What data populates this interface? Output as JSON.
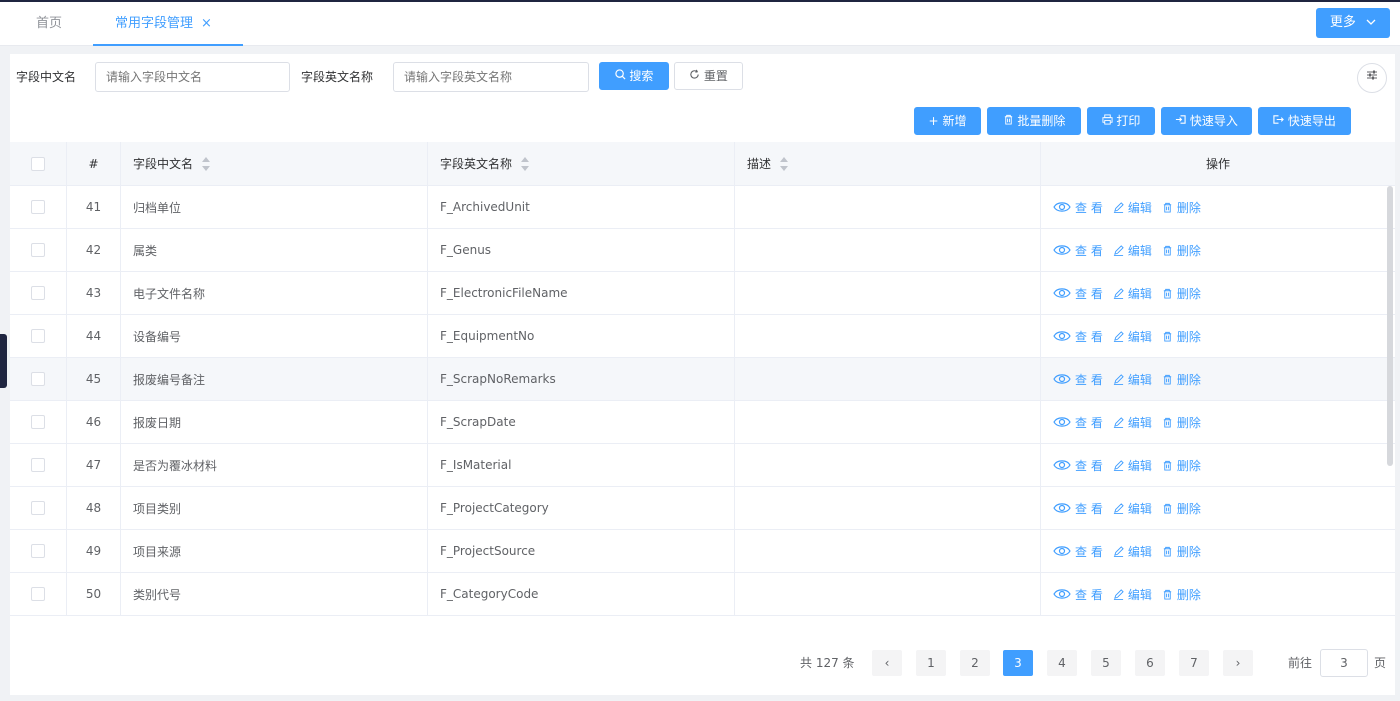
{
  "tabs": {
    "home": "首页",
    "active": "常用字段管理",
    "close": "×",
    "more": "更多"
  },
  "search": {
    "cn_label": "字段中文名",
    "cn_placeholder": "请输入字段中文名",
    "en_label": "字段英文名称",
    "en_placeholder": "请输入字段英文名称",
    "search_btn": "搜索",
    "reset_btn": "重置"
  },
  "toolbar": {
    "add": "新增",
    "batch_delete": "批量删除",
    "print": "打印",
    "import": "快速导入",
    "export": "快速导出"
  },
  "table": {
    "headers": {
      "index": "#",
      "cn": "字段中文名",
      "en": "字段英文名称",
      "desc": "描述",
      "op": "操作"
    },
    "actions": {
      "view": "查 看",
      "edit": "编辑",
      "delete": "删除"
    },
    "rows": [
      {
        "index": "41",
        "cn": "归档单位",
        "en": "F_ArchivedUnit",
        "desc": ""
      },
      {
        "index": "42",
        "cn": "属类",
        "en": "F_Genus",
        "desc": ""
      },
      {
        "index": "43",
        "cn": "电子文件名称",
        "en": "F_ElectronicFileName",
        "desc": ""
      },
      {
        "index": "44",
        "cn": "设备编号",
        "en": "F_EquipmentNo",
        "desc": ""
      },
      {
        "index": "45",
        "cn": "报废编号备注",
        "en": "F_ScrapNoRemarks",
        "desc": ""
      },
      {
        "index": "46",
        "cn": "报废日期",
        "en": "F_ScrapDate",
        "desc": ""
      },
      {
        "index": "47",
        "cn": "是否为覆冰材料",
        "en": "F_IsMaterial",
        "desc": ""
      },
      {
        "index": "48",
        "cn": "项目类别",
        "en": "F_ProjectCategory",
        "desc": ""
      },
      {
        "index": "49",
        "cn": "项目来源",
        "en": "F_ProjectSource",
        "desc": ""
      },
      {
        "index": "50",
        "cn": "类别代号",
        "en": "F_CategoryCode",
        "desc": ""
      }
    ]
  },
  "pagination": {
    "total": "共 127 条",
    "prev": "‹",
    "next": "›",
    "pages": [
      "1",
      "2",
      "3",
      "4",
      "5",
      "6",
      "7"
    ],
    "current": "3",
    "goto_label": "前往",
    "goto_value": "3",
    "page_suffix": "页"
  },
  "colors": {
    "primary": "#409eff",
    "header_bg": "#f5f7fa",
    "border": "#ebeef5"
  }
}
